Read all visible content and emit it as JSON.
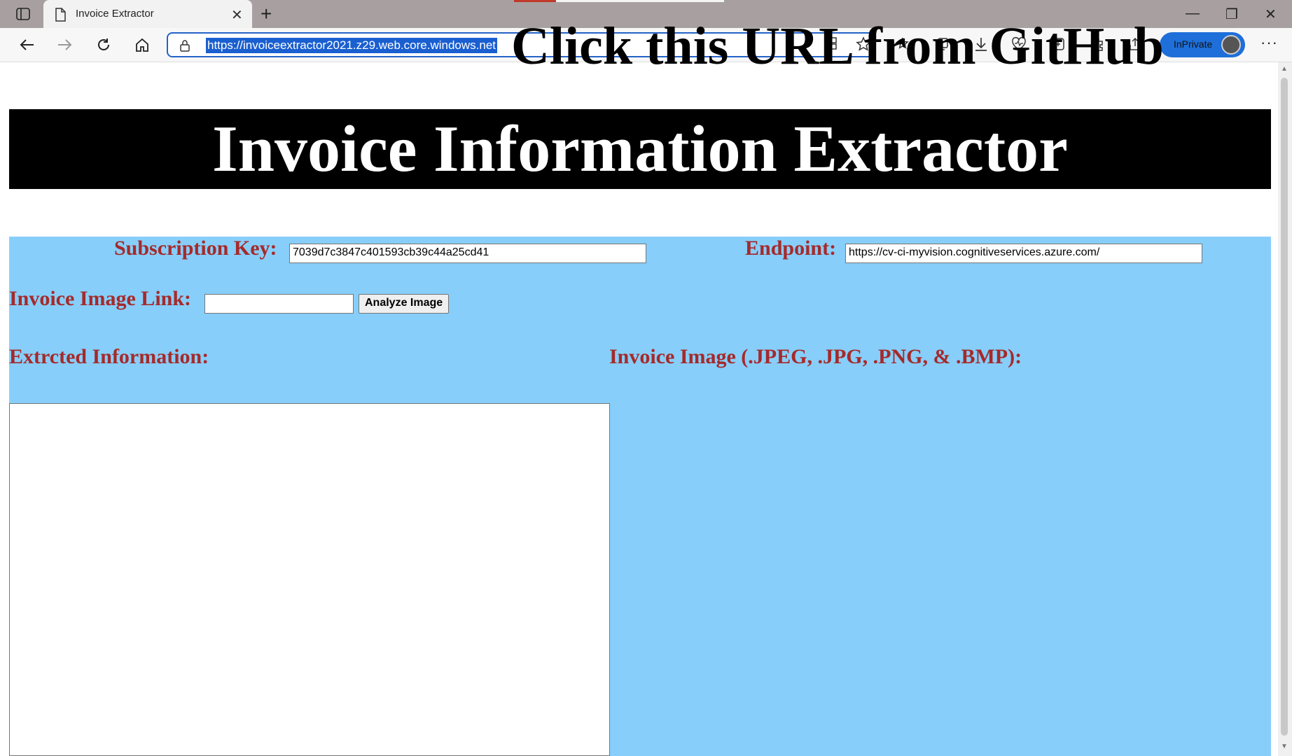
{
  "browser": {
    "tab_title": "Invoice Extractor",
    "tab_close": "✕",
    "new_tab": "+",
    "url": "https://invoiceextractor2021.z29.web.core.windows.net",
    "inprivate_label": "InPrivate",
    "window_controls": {
      "minimize": "—",
      "restore": "❐",
      "close": "✕"
    },
    "more_menu": "···",
    "accent_color": "#1e6fd9"
  },
  "overlay_caption": "Click this URL from GitHub",
  "page": {
    "title": "Invoice Information Extractor",
    "subscription_key_label": "Subscription Key:",
    "subscription_key_value": "7039d7c3847c401593cb39c44a25cd41",
    "endpoint_label": "Endpoint:",
    "endpoint_value": "https://cv-ci-myvision.cognitiveservices.azure.com/",
    "image_link_label": "Invoice Image Link:",
    "image_link_value": "",
    "analyze_button": "Analyze Image",
    "extracted_label": "Extrcted Information:",
    "invoice_image_label": "Invoice Image (.JPEG, .JPG, .PNG, & .BMP):",
    "panel_color": "#87cefa",
    "label_color": "#a52a2a"
  }
}
